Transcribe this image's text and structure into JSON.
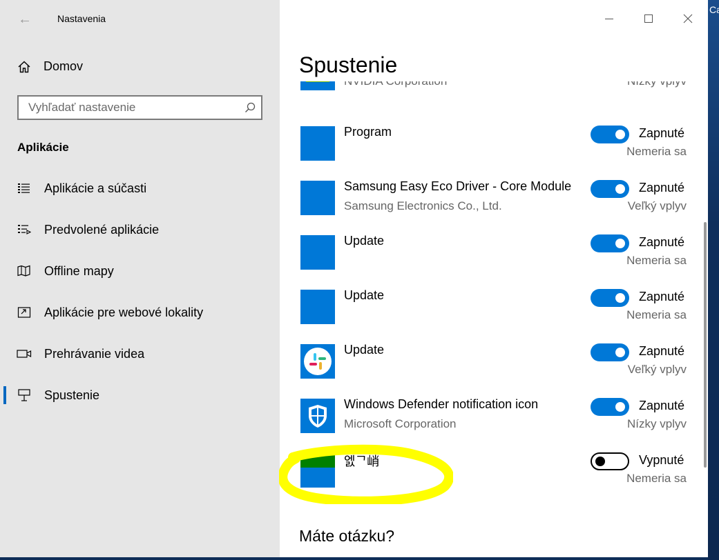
{
  "window": {
    "title": "Nastavenia",
    "controls": {
      "minimize": "minimize-icon",
      "maximize": "maximize-icon",
      "close": "close-icon"
    }
  },
  "desktop": {
    "edge_text": "Ca"
  },
  "sidebar": {
    "home_label": "Domov",
    "search_placeholder": "Vyhľadať nastavenie",
    "section_title": "Aplikácie",
    "items": [
      {
        "label": "Aplikácie a súčasti",
        "icon": "apps-list-icon"
      },
      {
        "label": "Predvolené aplikácie",
        "icon": "default-apps-icon"
      },
      {
        "label": "Offline mapy",
        "icon": "map-icon"
      },
      {
        "label": "Aplikácie pre webové lokality",
        "icon": "web-apps-icon"
      },
      {
        "label": "Prehrávanie videa",
        "icon": "video-icon"
      },
      {
        "label": "Spustenie",
        "icon": "startup-icon",
        "selected": true
      }
    ]
  },
  "main": {
    "title": "Spustenie",
    "startup_apps": [
      {
        "name": "",
        "publisher": "NVIDIA Corporation",
        "state": "",
        "impact": "Nízky vplyv",
        "icon": "nvidia-icon",
        "enabled": true
      },
      {
        "name": "Program",
        "publisher": "",
        "state": "Zapnuté",
        "impact": "Nemeria sa",
        "icon": "blank-app-icon",
        "enabled": true
      },
      {
        "name": "Samsung Easy Eco Driver - Core Module",
        "publisher": "Samsung Electronics Co., Ltd.",
        "state": "Zapnuté",
        "impact": "Veľký vplyv",
        "icon": "blank-app-icon",
        "enabled": true
      },
      {
        "name": "Update",
        "publisher": "",
        "state": "Zapnuté",
        "impact": "Nemeria sa",
        "icon": "blank-app-icon",
        "enabled": true
      },
      {
        "name": "Update",
        "publisher": "",
        "state": "Zapnuté",
        "impact": "Nemeria sa",
        "icon": "blank-app-icon",
        "enabled": true
      },
      {
        "name": "Update",
        "publisher": "",
        "state": "Zapnuté",
        "impact": "Veľký vplyv",
        "icon": "slack-icon",
        "enabled": true
      },
      {
        "name": "Windows Defender notification icon",
        "publisher": "Microsoft Corporation",
        "state": "Zapnuté",
        "impact": "Nízky vplyv",
        "icon": "defender-shield-icon",
        "enabled": true
      },
      {
        "name": "엜ᄀ峭",
        "publisher": "",
        "state": "Vypnuté",
        "impact": "Nemeria sa",
        "icon": "unknown-app-icon",
        "enabled": false
      }
    ],
    "question_heading": "Máte otázku?"
  },
  "colors": {
    "accent": "#0078d7",
    "sidebar_bg": "#e6e6e6",
    "highlight": "#ffff00"
  }
}
